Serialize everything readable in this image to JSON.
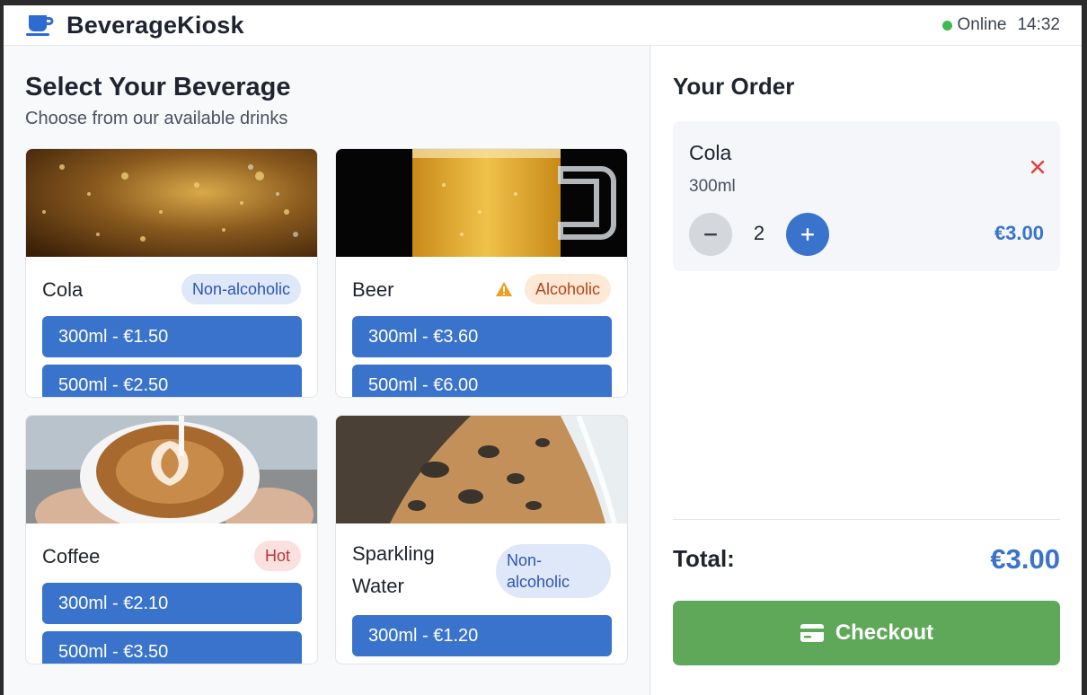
{
  "app": {
    "title": "BeverageKiosk",
    "status": "Online",
    "time": "14:32"
  },
  "menu": {
    "title": "Select Your Beverage",
    "subtitle": "Choose from our available drinks",
    "items": [
      {
        "name": "Cola",
        "badge": "Non-alcoholic",
        "options": [
          "300ml - €1.50",
          "500ml - €2.50"
        ]
      },
      {
        "name": "Beer",
        "badge": "Alcoholic",
        "options": [
          "300ml - €3.60",
          "500ml - €6.00"
        ]
      },
      {
        "name": "Coffee",
        "badge": "Hot",
        "options": [
          "300ml - €2.10",
          "500ml - €3.50"
        ]
      },
      {
        "name": "Sparkling Water",
        "badge": "Non-alcoholic",
        "options": [
          "300ml - €1.20"
        ]
      }
    ]
  },
  "order": {
    "title": "Your Order",
    "items": [
      {
        "name": "Cola",
        "size": "300ml",
        "quantity": "2",
        "price": "€3.00"
      }
    ],
    "total_label": "Total:",
    "total_value": "€3.00",
    "checkout_label": "Checkout"
  },
  "colors": {
    "primary": "#3a73cc",
    "success": "#5fa85a",
    "online": "#3fb950",
    "warning": "#f0a020",
    "danger": "#e0403a"
  },
  "icons": {
    "brand": "coffee-cup-icon",
    "warning": "warning-triangle-icon",
    "remove": "close-icon",
    "checkout": "credit-card-icon"
  }
}
